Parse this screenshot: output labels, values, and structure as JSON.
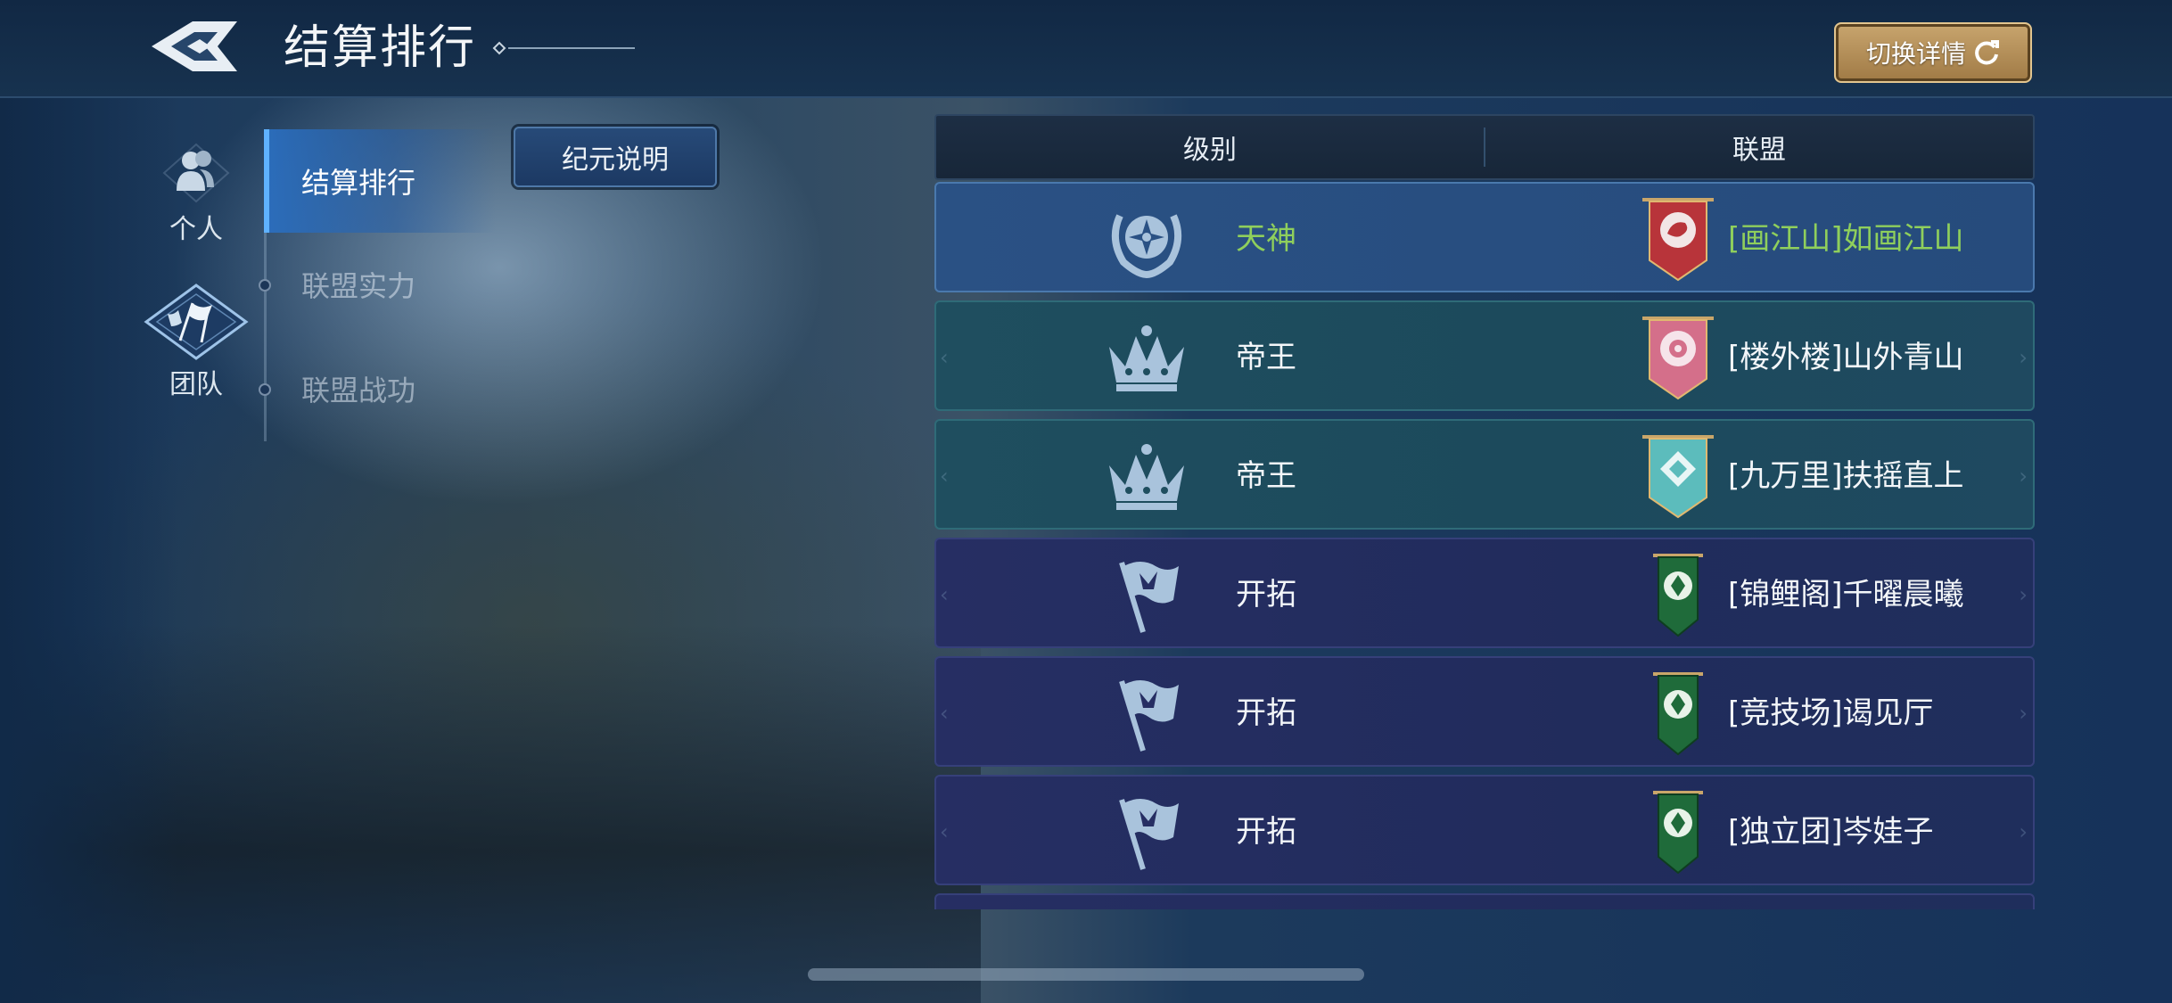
{
  "header": {
    "title": "结算排行",
    "switch_label": "切换详情"
  },
  "sidebar": {
    "categories": [
      {
        "label": "个人"
      },
      {
        "label": "团队"
      }
    ],
    "subnav": [
      {
        "label": "结算排行"
      },
      {
        "label": "联盟实力"
      },
      {
        "label": "联盟战功"
      }
    ],
    "era_button": "纪元说明"
  },
  "table": {
    "columns": [
      "级别",
      "联盟"
    ],
    "rows": [
      {
        "rank": "天神",
        "alliance": "[画江山]如画江山",
        "rank_icon": "laurel-emblem-icon",
        "banner": "red-dragon-banner-icon",
        "highlight_color": "#8fcf5c"
      },
      {
        "rank": "帝王",
        "alliance": "[楼外楼]山外青山",
        "rank_icon": "crown-icon",
        "banner": "pink-flower-banner-icon"
      },
      {
        "rank": "帝王",
        "alliance": "[九万里]扶摇直上",
        "rank_icon": "crown-icon",
        "banner": "teal-wings-banner-icon"
      },
      {
        "rank": "开拓",
        "alliance": "[锦鲤阁]千曜晨曦",
        "rank_icon": "flag-icon",
        "banner": "green-crest-banner-icon"
      },
      {
        "rank": "开拓",
        "alliance": "[竞技场]谒见厅",
        "rank_icon": "flag-icon",
        "banner": "green-crest-banner-icon"
      },
      {
        "rank": "开拓",
        "alliance": "[独立团]岑娃子",
        "rank_icon": "flag-icon",
        "banner": "green-crest-banner-icon"
      }
    ]
  },
  "colors": {
    "accent_blue": "#5fb2ff",
    "gold_button": "#b38d57",
    "top_rank_text": "#8fcf5c"
  }
}
